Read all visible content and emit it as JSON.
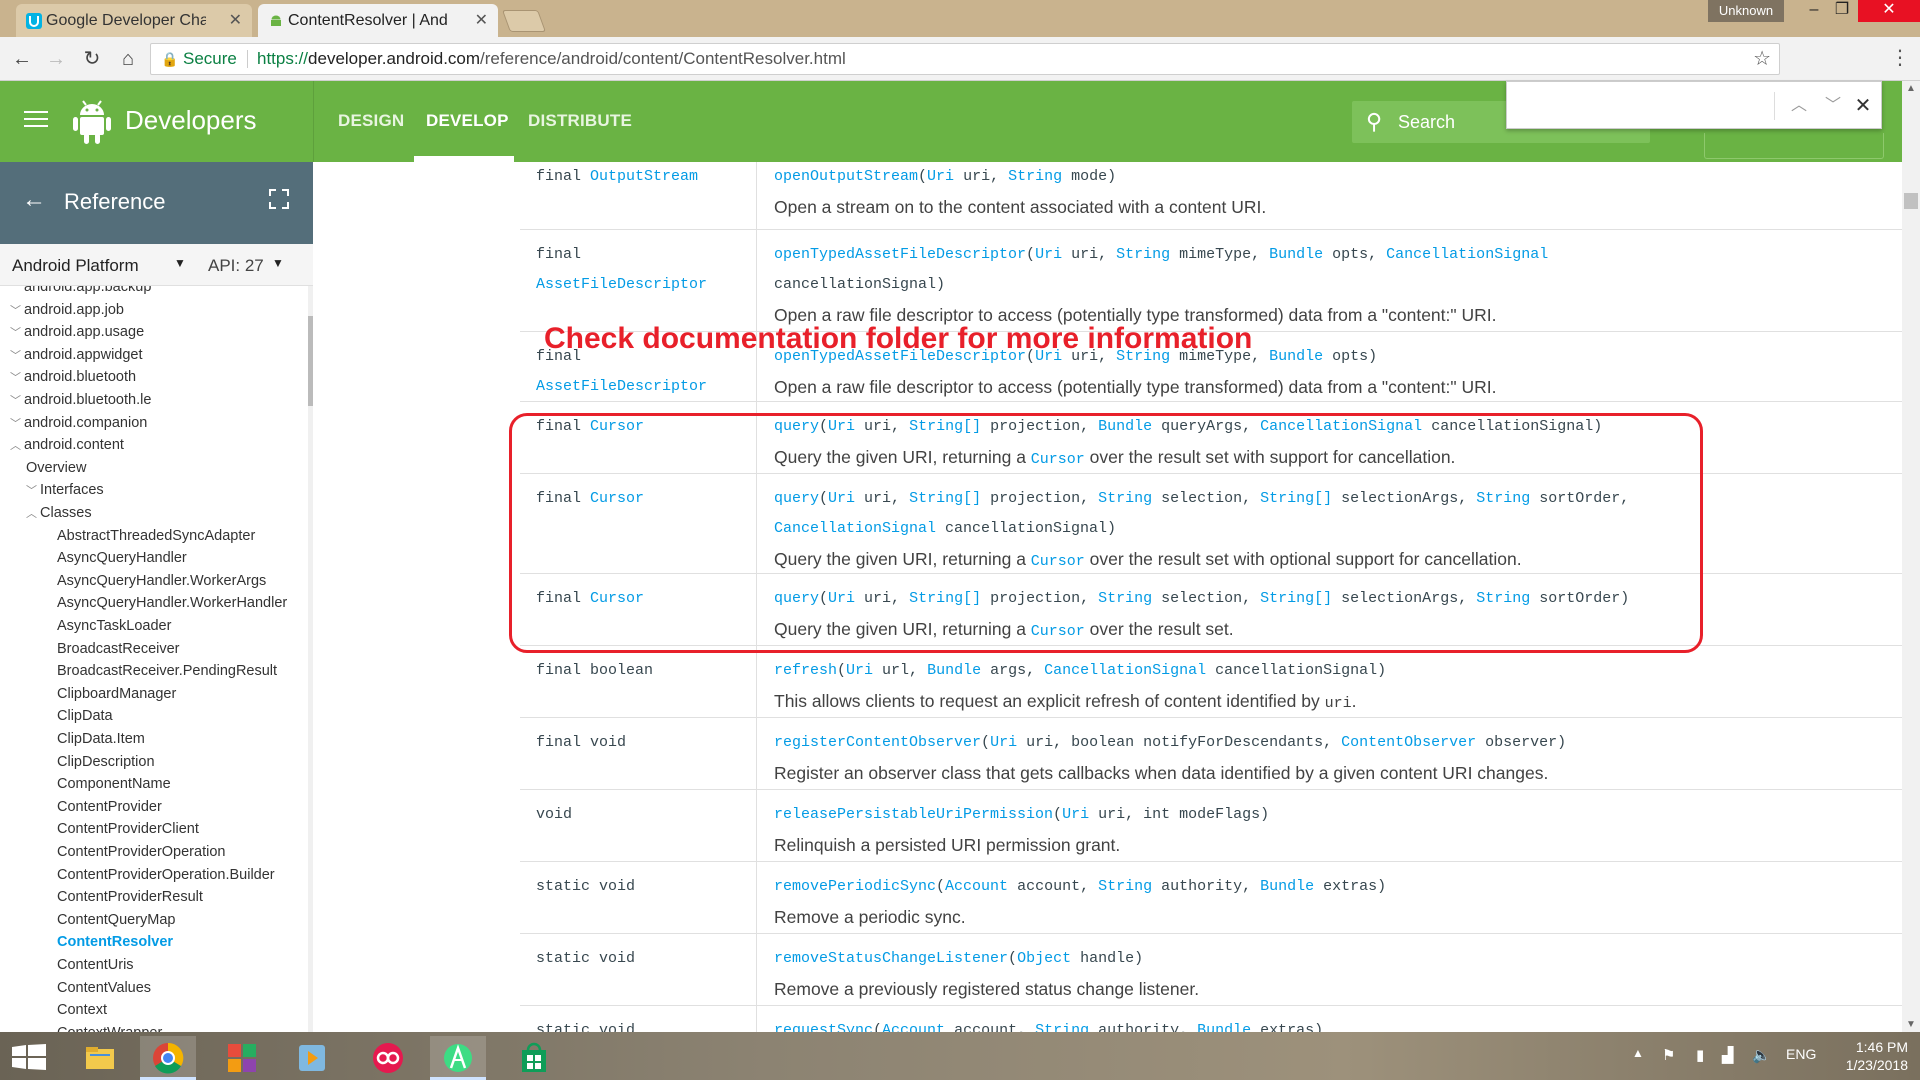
{
  "browser": {
    "tabs": [
      {
        "title": "Google Developer Challe",
        "active": false
      },
      {
        "title": "ContentResolver | Androi",
        "active": true
      }
    ],
    "profile_label": "Unknown",
    "secure_label": "Secure",
    "url_scheme": "https://",
    "url_host": "developer.android.com",
    "url_path": "/reference/android/content/ContentResolver.html"
  },
  "site": {
    "brand": "Developers",
    "nav": [
      "DESIGN",
      "DEVELOP",
      "DISTRIBUTE"
    ],
    "active_nav": "DEVELOP",
    "search_label": "Search",
    "find_value": ""
  },
  "sidebar": {
    "title": "Reference",
    "platform": "Android Platform",
    "api": "API: 27",
    "items": [
      {
        "label": "android.app.backup",
        "level": 0,
        "chev": "v"
      },
      {
        "label": "android.app.job",
        "level": 0,
        "chev": "v"
      },
      {
        "label": "android.app.usage",
        "level": 0,
        "chev": "v"
      },
      {
        "label": "android.appwidget",
        "level": 0,
        "chev": "v"
      },
      {
        "label": "android.bluetooth",
        "level": 0,
        "chev": "v"
      },
      {
        "label": "android.bluetooth.le",
        "level": 0,
        "chev": "v"
      },
      {
        "label": "android.companion",
        "level": 0,
        "chev": "v"
      },
      {
        "label": "android.content",
        "level": 0,
        "chev": "^"
      },
      {
        "label": "Overview",
        "level": 1,
        "chev": ""
      },
      {
        "label": "Interfaces",
        "level": 1,
        "chev": "v"
      },
      {
        "label": "Classes",
        "level": 1,
        "chev": "^"
      },
      {
        "label": "AbstractThreadedSyncAdapter",
        "level": 2,
        "chev": ""
      },
      {
        "label": "AsyncQueryHandler",
        "level": 2,
        "chev": ""
      },
      {
        "label": "AsyncQueryHandler.WorkerArgs",
        "level": 2,
        "chev": ""
      },
      {
        "label": "AsyncQueryHandler.WorkerHandler",
        "level": 2,
        "chev": ""
      },
      {
        "label": "AsyncTaskLoader",
        "level": 2,
        "chev": ""
      },
      {
        "label": "BroadcastReceiver",
        "level": 2,
        "chev": ""
      },
      {
        "label": "BroadcastReceiver.PendingResult",
        "level": 2,
        "chev": ""
      },
      {
        "label": "ClipboardManager",
        "level": 2,
        "chev": ""
      },
      {
        "label": "ClipData",
        "level": 2,
        "chev": ""
      },
      {
        "label": "ClipData.Item",
        "level": 2,
        "chev": ""
      },
      {
        "label": "ClipDescription",
        "level": 2,
        "chev": ""
      },
      {
        "label": "ComponentName",
        "level": 2,
        "chev": ""
      },
      {
        "label": "ContentProvider",
        "level": 2,
        "chev": ""
      },
      {
        "label": "ContentProviderClient",
        "level": 2,
        "chev": ""
      },
      {
        "label": "ContentProviderOperation",
        "level": 2,
        "chev": ""
      },
      {
        "label": "ContentProviderOperation.Builder",
        "level": 2,
        "chev": ""
      },
      {
        "label": "ContentProviderResult",
        "level": 2,
        "chev": ""
      },
      {
        "label": "ContentQueryMap",
        "level": 2,
        "chev": ""
      },
      {
        "label": "ContentResolver",
        "level": 2,
        "chev": "",
        "current": true
      },
      {
        "label": "ContentUris",
        "level": 2,
        "chev": ""
      },
      {
        "label": "ContentValues",
        "level": 2,
        "chev": ""
      },
      {
        "label": "Context",
        "level": 2,
        "chev": ""
      },
      {
        "label": "ContextWrapper",
        "level": 2,
        "chev": ""
      }
    ]
  },
  "annotation": "Check documentation folder for more information",
  "methods": [
    {
      "rtype": [
        [
          "final ",
          ""
        ],
        [
          "OutputStream",
          "lk"
        ]
      ],
      "sig": [
        [
          [
            "openOutputStream",
            "lk"
          ],
          [
            "(",
            ""
          ],
          [
            "Uri",
            "lk"
          ],
          [
            " uri, ",
            ""
          ],
          [
            "String",
            "lk"
          ],
          [
            " mode)",
            ""
          ]
        ]
      ],
      "desc": [
        [
          "Open a stream on to the content associated with a content URI.",
          ""
        ]
      ]
    },
    {
      "rtype": [
        [
          "final",
          ""
        ],
        [
          "\n",
          ""
        ],
        [
          "AssetFileDescriptor",
          "lk"
        ]
      ],
      "sig": [
        [
          [
            "openTypedAssetFileDescriptor",
            "lk"
          ],
          [
            "(",
            ""
          ],
          [
            "Uri",
            "lk"
          ],
          [
            " uri, ",
            ""
          ],
          [
            "String",
            "lk"
          ],
          [
            " mimeType, ",
            ""
          ],
          [
            "Bundle",
            "lk"
          ],
          [
            " opts, ",
            ""
          ],
          [
            "CancellationSignal",
            "lk"
          ]
        ],
        [
          [
            "cancellationSignal)",
            ""
          ]
        ]
      ],
      "desc": [
        [
          "Open a raw file descriptor to access (potentially type transformed) data from a \"content:\" URI.",
          ""
        ]
      ]
    },
    {
      "rtype": [
        [
          "final",
          ""
        ],
        [
          "\n",
          ""
        ],
        [
          "AssetFileDescriptor",
          "lk"
        ]
      ],
      "sig": [
        [
          [
            "openTypedAssetFileDescriptor",
            "lk"
          ],
          [
            "(",
            ""
          ],
          [
            "Uri",
            "lk"
          ],
          [
            " uri, ",
            ""
          ],
          [
            "String",
            "lk"
          ],
          [
            " mimeType, ",
            ""
          ],
          [
            "Bundle",
            "lk"
          ],
          [
            " opts)",
            ""
          ]
        ]
      ],
      "desc": [
        [
          "Open a raw file descriptor to access (potentially type transformed) data from a \"content:\" URI.",
          ""
        ]
      ]
    },
    {
      "rtype": [
        [
          "final ",
          ""
        ],
        [
          "Cursor",
          "lk"
        ]
      ],
      "sig": [
        [
          [
            "query",
            "lk"
          ],
          [
            "(",
            ""
          ],
          [
            "Uri",
            "lk"
          ],
          [
            " uri, ",
            ""
          ],
          [
            "String[]",
            "lk"
          ],
          [
            " projection, ",
            ""
          ],
          [
            "Bundle",
            "lk"
          ],
          [
            " queryArgs, ",
            ""
          ],
          [
            "CancellationSignal",
            "lk"
          ],
          [
            " cancellationSignal)",
            ""
          ]
        ]
      ],
      "desc": [
        [
          "Query the given URI, returning a ",
          ""
        ],
        [
          "Cursor",
          "lk mono"
        ],
        [
          " over the result set with support for cancellation.",
          ""
        ]
      ]
    },
    {
      "rtype": [
        [
          "final ",
          ""
        ],
        [
          "Cursor",
          "lk"
        ]
      ],
      "sig": [
        [
          [
            "query",
            "lk"
          ],
          [
            "(",
            ""
          ],
          [
            "Uri",
            "lk"
          ],
          [
            " uri, ",
            ""
          ],
          [
            "String[]",
            "lk"
          ],
          [
            " projection, ",
            ""
          ],
          [
            "String",
            "lk"
          ],
          [
            " selection, ",
            ""
          ],
          [
            "String[]",
            "lk"
          ],
          [
            " selectionArgs, ",
            ""
          ],
          [
            "String",
            "lk"
          ],
          [
            " sortOrder,",
            ""
          ]
        ],
        [
          [
            "CancellationSignal",
            "lk"
          ],
          [
            " cancellationSignal)",
            ""
          ]
        ]
      ],
      "desc": [
        [
          "Query the given URI, returning a ",
          ""
        ],
        [
          "Cursor",
          "lk mono"
        ],
        [
          " over the result set with optional support for cancellation.",
          ""
        ]
      ]
    },
    {
      "rtype": [
        [
          "final ",
          ""
        ],
        [
          "Cursor",
          "lk"
        ]
      ],
      "sig": [
        [
          [
            "query",
            "lk"
          ],
          [
            "(",
            ""
          ],
          [
            "Uri",
            "lk"
          ],
          [
            " uri, ",
            ""
          ],
          [
            "String[]",
            "lk"
          ],
          [
            " projection, ",
            ""
          ],
          [
            "String",
            "lk"
          ],
          [
            " selection, ",
            ""
          ],
          [
            "String[]",
            "lk"
          ],
          [
            " selectionArgs, ",
            ""
          ],
          [
            "String",
            "lk"
          ],
          [
            " sortOrder)",
            ""
          ]
        ]
      ],
      "desc": [
        [
          "Query the given URI, returning a ",
          ""
        ],
        [
          "Cursor",
          "lk mono"
        ],
        [
          " over the result set.",
          ""
        ]
      ]
    },
    {
      "rtype": [
        [
          "final boolean",
          ""
        ]
      ],
      "sig": [
        [
          [
            "refresh",
            "lk"
          ],
          [
            "(",
            ""
          ],
          [
            "Uri",
            "lk"
          ],
          [
            " url, ",
            ""
          ],
          [
            "Bundle",
            "lk"
          ],
          [
            " args, ",
            ""
          ],
          [
            "CancellationSignal",
            "lk"
          ],
          [
            " cancellationSignal)",
            ""
          ]
        ]
      ],
      "desc": [
        [
          "This allows clients to request an explicit refresh of content identified by ",
          ""
        ],
        [
          "uri",
          "mono"
        ],
        [
          ".",
          ""
        ]
      ]
    },
    {
      "rtype": [
        [
          "final void",
          ""
        ]
      ],
      "sig": [
        [
          [
            "registerContentObserver",
            "lk"
          ],
          [
            "(",
            ""
          ],
          [
            "Uri",
            "lk"
          ],
          [
            " uri, boolean notifyForDescendants, ",
            ""
          ],
          [
            "ContentObserver",
            "lk"
          ],
          [
            " observer)",
            ""
          ]
        ]
      ],
      "desc": [
        [
          "Register an observer class that gets callbacks when data identified by a given content URI changes.",
          ""
        ]
      ]
    },
    {
      "rtype": [
        [
          "void",
          ""
        ]
      ],
      "sig": [
        [
          [
            "releasePersistableUriPermission",
            "lk"
          ],
          [
            "(",
            ""
          ],
          [
            "Uri",
            "lk"
          ],
          [
            " uri, int modeFlags)",
            ""
          ]
        ]
      ],
      "desc": [
        [
          "Relinquish a persisted URI permission grant.",
          ""
        ]
      ]
    },
    {
      "rtype": [
        [
          "static void",
          ""
        ]
      ],
      "sig": [
        [
          [
            "removePeriodicSync",
            "lk"
          ],
          [
            "(",
            ""
          ],
          [
            "Account",
            "lk"
          ],
          [
            " account, ",
            ""
          ],
          [
            "String",
            "lk"
          ],
          [
            " authority, ",
            ""
          ],
          [
            "Bundle",
            "lk"
          ],
          [
            " extras)",
            ""
          ]
        ]
      ],
      "desc": [
        [
          "Remove a periodic sync.",
          ""
        ]
      ]
    },
    {
      "rtype": [
        [
          "static void",
          ""
        ]
      ],
      "sig": [
        [
          [
            "removeStatusChangeListener",
            "lk"
          ],
          [
            "(",
            ""
          ],
          [
            "Object",
            "lk"
          ],
          [
            " handle)",
            ""
          ]
        ]
      ],
      "desc": [
        [
          "Remove a previously registered status change listener.",
          ""
        ]
      ]
    },
    {
      "rtype": [
        [
          "static void",
          ""
        ]
      ],
      "sig": [
        [
          [
            "requestSync",
            "lk"
          ],
          [
            "(",
            ""
          ],
          [
            "Account",
            "lk"
          ],
          [
            " account, ",
            ""
          ],
          [
            "String",
            "lk"
          ],
          [
            " authority, ",
            ""
          ],
          [
            "Bundle",
            "lk"
          ],
          [
            " extras)",
            ""
          ]
        ]
      ],
      "desc": []
    }
  ],
  "taskbar": {
    "language": "ENG",
    "time": "1:46 PM",
    "date": "1/23/2018"
  },
  "colors": {
    "header_green": "#6ab344",
    "reference_bar": "#546e7a",
    "link_blue": "#039be5",
    "annotation_red": "#e8202a"
  }
}
